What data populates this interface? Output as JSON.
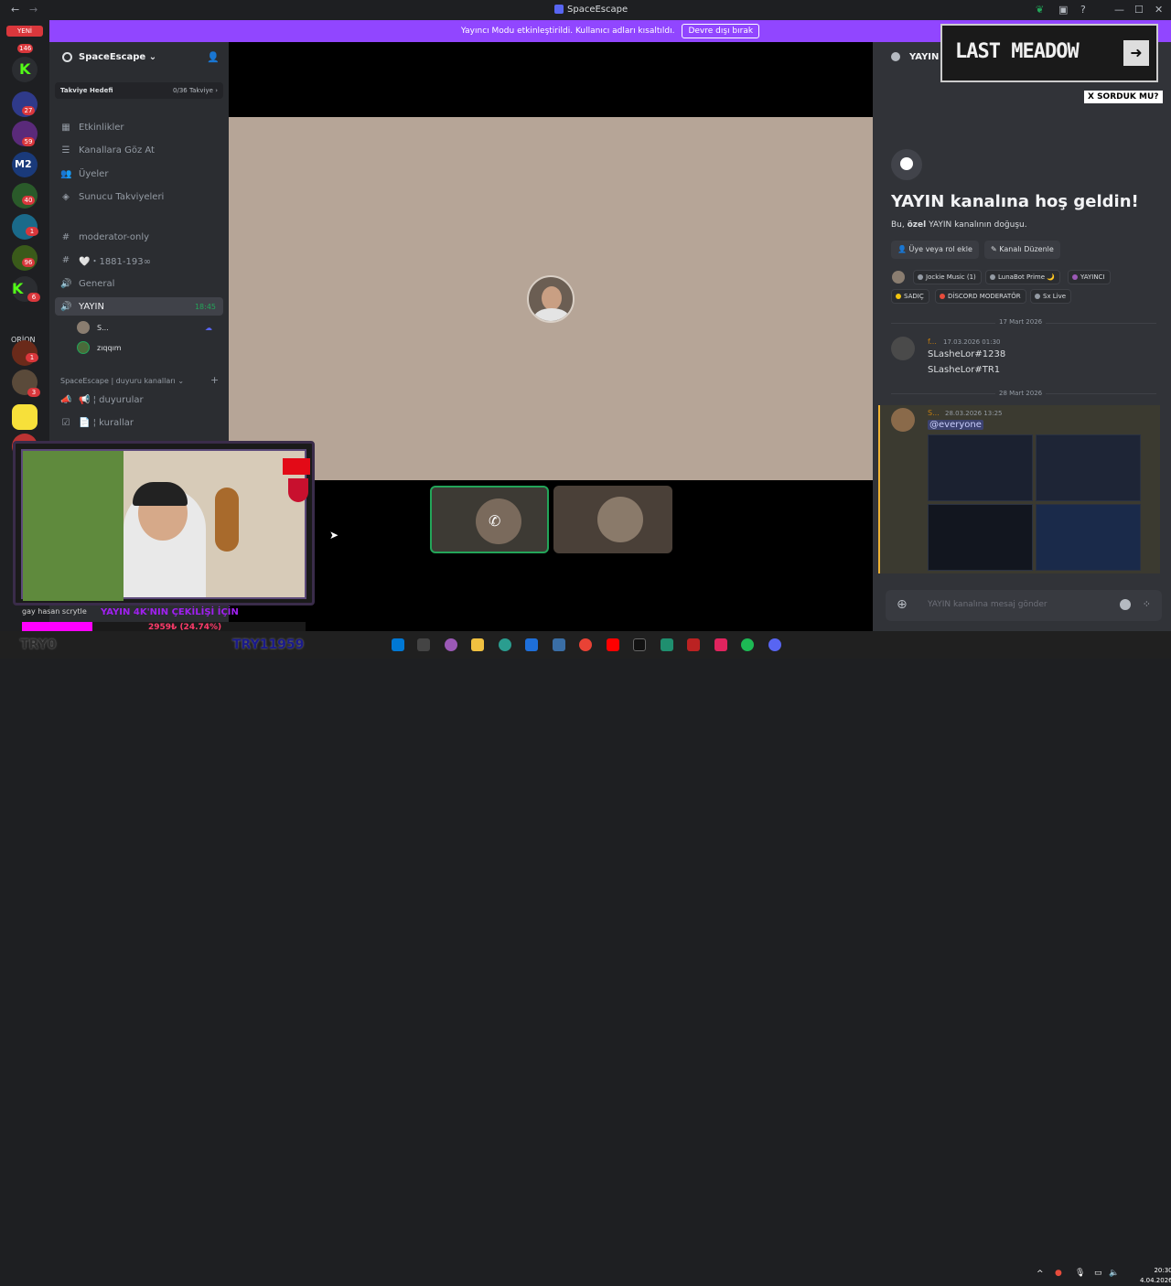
{
  "window": {
    "title": "SpaceEscape"
  },
  "banner": {
    "text": "Yayıncı Modu etkinleştirildi. Kullanıcı adları kısaltıldı.",
    "button": "Devre dışı bırak"
  },
  "guilds": {
    "yeni": "YENİ",
    "badges": [
      "146",
      "27",
      "59",
      "40",
      "1",
      "96",
      "6",
      "1",
      "3"
    ],
    "orion": "ORİON"
  },
  "server": {
    "name": "SpaceEscape",
    "boost_label": "Takviye Hedefi",
    "boost_value": "0/36 Takviye",
    "nav": [
      {
        "label": "Etkinlikler",
        "icon": "calendar-icon"
      },
      {
        "label": "Kanallara Göz At",
        "icon": "list-icon"
      },
      {
        "label": "Üyeler",
        "icon": "users-icon"
      },
      {
        "label": "Sunucu Takviyeleri",
        "icon": "boost-icon"
      }
    ],
    "channels": [
      {
        "label": "moderator-only",
        "icon": "hash-icon"
      },
      {
        "label": "🤍・1881-193∞",
        "icon": "hash-icon"
      },
      {
        "label": "General",
        "icon": "speaker-icon"
      },
      {
        "label": "YAYIN",
        "icon": "speaker-icon",
        "time": "18:45"
      }
    ],
    "voice_users": [
      "S...",
      "zıqqım"
    ],
    "category": "SpaceEscape | duyuru kanalları",
    "category_channels": [
      {
        "label": "📢 ¦ duyurular",
        "icon": "megaphone-icon"
      },
      {
        "label": "📄 ¦ kurallar",
        "icon": "rules-icon"
      }
    ]
  },
  "overlay": {
    "chat_line": "gay hasan scrytle",
    "goal_text": "YAYIN 4K'NIN ÇEKİLİŞİ İÇİN",
    "progress_label": "2959₺ (24.74%)",
    "progress_percent": 24.74,
    "try_left": "TRY0",
    "try_right": "TRY11959"
  },
  "chat": {
    "channel": "YAYIN",
    "ad_text": "LAST MEADOW",
    "ad_tag": "X SORDUK MU?",
    "welcome_title": "YAYIN kanalına hoş geldin!",
    "welcome_prefix": "Bu,",
    "welcome_bold": "özel",
    "welcome_suffix": "YAYIN kanalının doğuşu.",
    "btn_add": "Üye veya rol ekle",
    "btn_edit": "Kanalı Düzenle",
    "roles": [
      {
        "label": "Jockie Music (1)",
        "color": "#949ba4"
      },
      {
        "label": "LunaBot Prime 🌙",
        "color": "#949ba4"
      },
      {
        "label": "YAYINCI",
        "color": "#9b59b6"
      },
      {
        "label": "SADIÇ",
        "color": "#f1c40f"
      },
      {
        "label": "DİSCORD MODERATÖR",
        "color": "#e74c3c"
      },
      {
        "label": "Sx Live",
        "color": "#949ba4"
      }
    ],
    "date1": "17 Mart 2026",
    "msg1": {
      "author": "f...",
      "time": "17.03.2026 01:30",
      "lines": [
        "SLasheLor#1238",
        "SLasheLor#TR1"
      ]
    },
    "date2": "28 Mart 2026",
    "msg2": {
      "author": "S...",
      "time": "28.03.2026 13:25",
      "mention": "@everyone"
    },
    "input_placeholder": "YAYIN kanalına mesaj gönder"
  },
  "clock": {
    "time": "20:30",
    "date": "4.04.2026"
  }
}
